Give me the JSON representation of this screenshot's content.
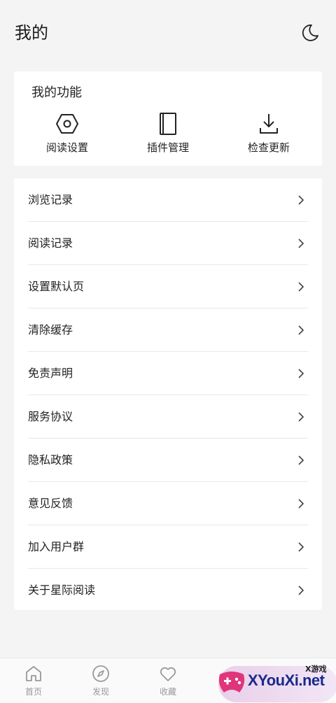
{
  "header": {
    "title": "我的",
    "theme_icon": "moon-icon"
  },
  "functions": {
    "title": "我的功能",
    "items": [
      {
        "label": "阅读设置",
        "icon": "hexagon-nut-icon"
      },
      {
        "label": "插件管理",
        "icon": "book-icon"
      },
      {
        "label": "检查更新",
        "icon": "download-icon"
      }
    ]
  },
  "menu": [
    "浏览记录",
    "阅读记录",
    "设置默认页",
    "清除缓存",
    "免责声明",
    "服务协议",
    "隐私政策",
    "意见反馈",
    "加入用户群",
    "关于星际阅读"
  ],
  "tabbar": [
    {
      "label": "首页",
      "icon": "home-icon"
    },
    {
      "label": "发现",
      "icon": "compass-icon"
    },
    {
      "label": "收藏",
      "icon": "heart-icon"
    }
  ],
  "watermark": {
    "small": "X游戏",
    "text": "XYouXi.net"
  },
  "colors": {
    "background": "#f4f4f4",
    "card": "#ffffff",
    "text": "#222222",
    "tab_inactive": "#999999"
  }
}
